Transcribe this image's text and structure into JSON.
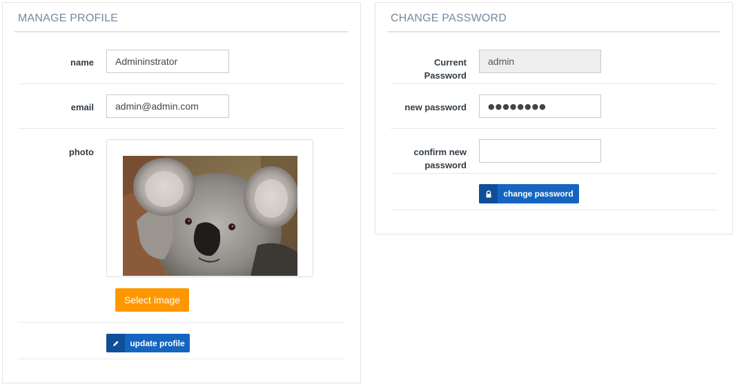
{
  "profile": {
    "title": "MANAGE PROFILE",
    "name_label": "name",
    "name_value": "Admininstrator",
    "email_label": "email",
    "email_value": "admin@admin.com",
    "photo_label": "photo",
    "select_image_label": "Select image",
    "update_label": "update profile",
    "update_icon": "pencil-icon"
  },
  "password": {
    "title": "CHANGE PASSWORD",
    "current_label_line1": "Current",
    "current_label_line2": "Password",
    "current_value": "admin",
    "new_label": "new password",
    "new_value": "●●●●●●●●",
    "confirm_label_line1": "confirm new",
    "confirm_label_line2": "password",
    "confirm_value": "",
    "change_label": "change password",
    "change_icon": "lock-icon"
  },
  "colors": {
    "title": "#7388a1",
    "primary_button": "#1565c0",
    "select_button": "#ff9800"
  }
}
